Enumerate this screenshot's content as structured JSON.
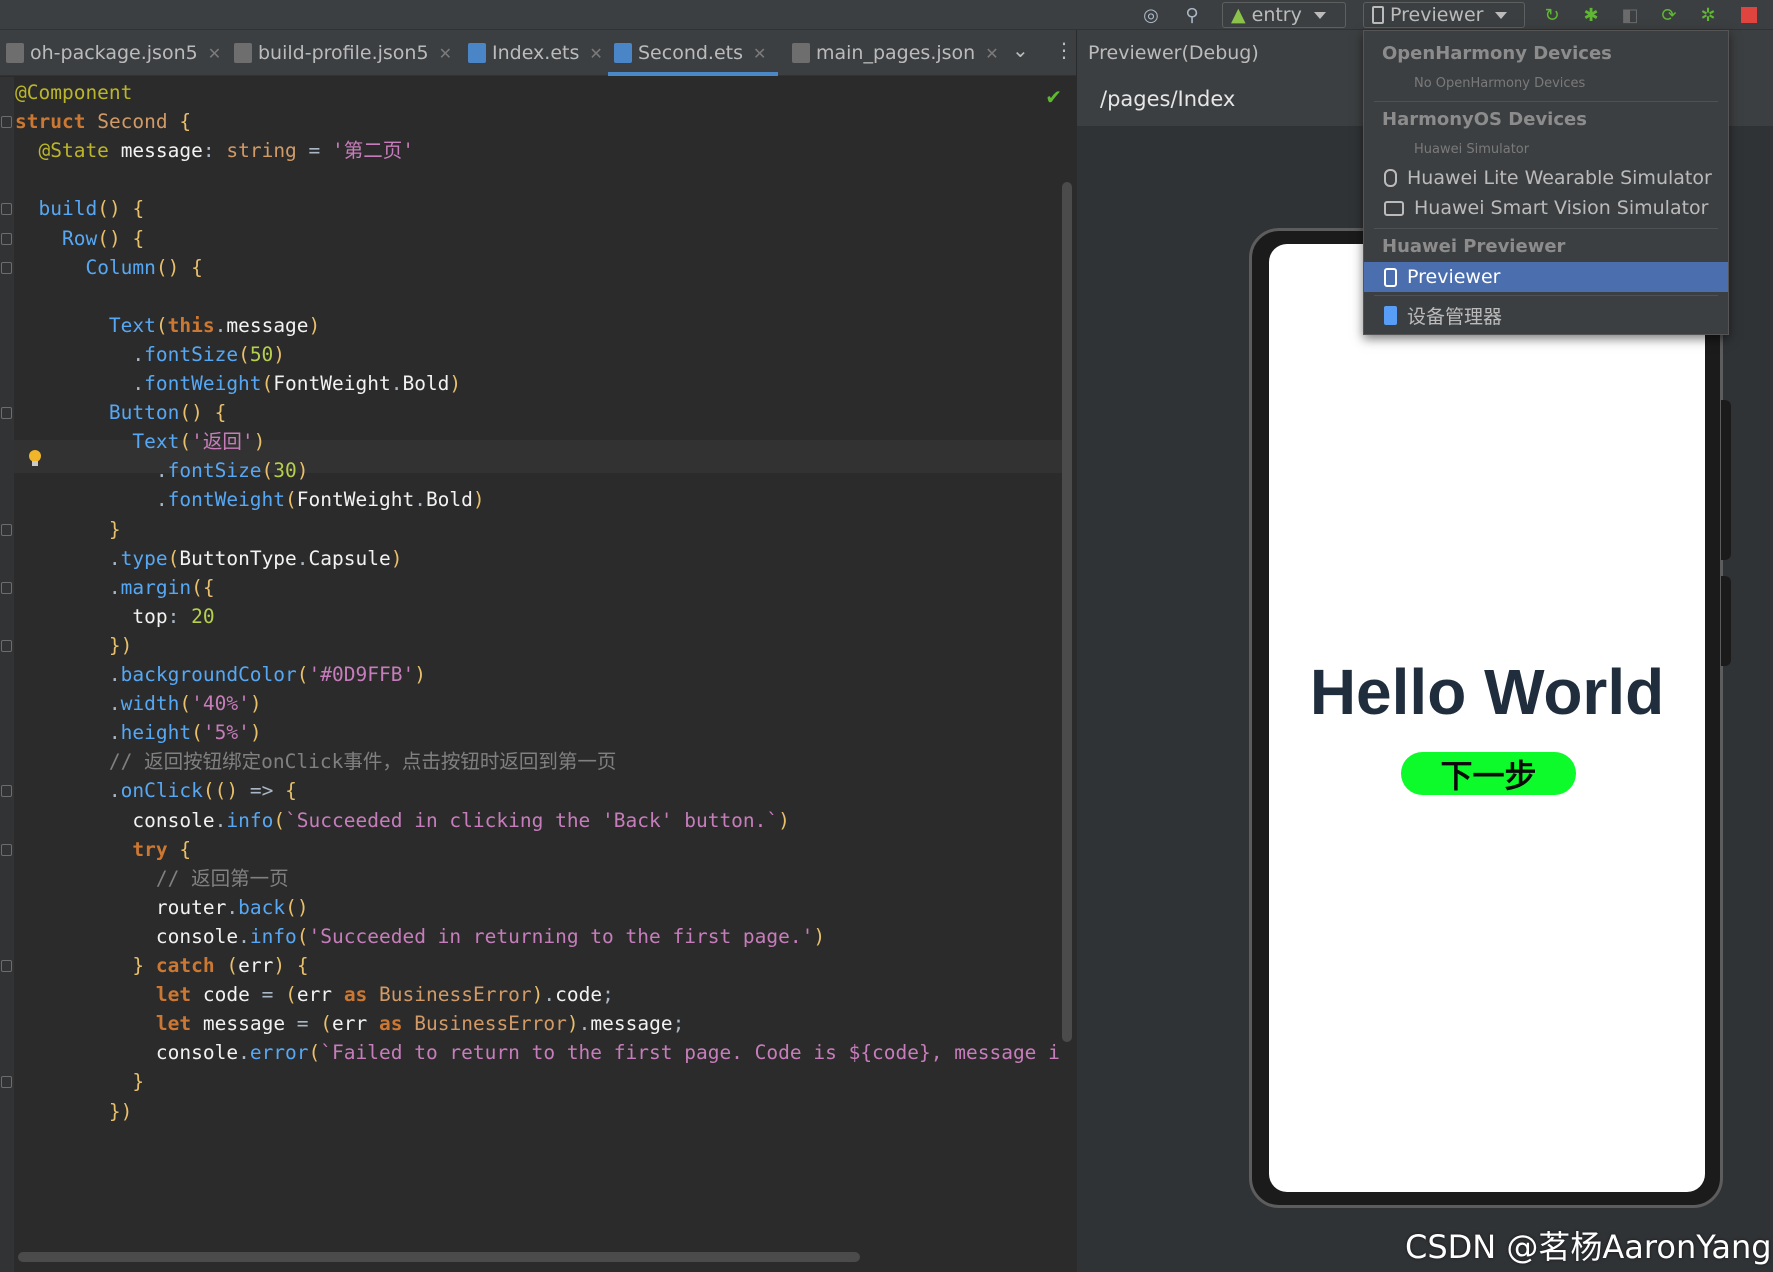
{
  "toolbar": {
    "module_combo": "entry",
    "device_combo": "Previewer"
  },
  "tabs": [
    {
      "label": "oh-package.json5",
      "type": "json"
    },
    {
      "label": "build-profile.json5",
      "type": "json"
    },
    {
      "label": "Index.ets",
      "type": "ets"
    },
    {
      "label": "Second.ets",
      "type": "ets",
      "active": true
    },
    {
      "label": "main_pages.json",
      "type": "json"
    }
  ],
  "editor": {
    "file": "Second.ets",
    "lines": [
      "@Component",
      "struct Second {",
      "  @State message: string = '第二页'",
      "",
      "  build() {",
      "    Row() {",
      "      Column() {",
      "",
      "        Text(this.message)",
      "          .fontSize(50)",
      "          .fontWeight(FontWeight.Bold)",
      "        Button() {",
      "          Text('返回')",
      "            .fontSize(30)",
      "            .fontWeight(FontWeight.Bold)",
      "        }",
      "        .type(ButtonType.Capsule)",
      "        .margin({",
      "          top: 20",
      "        })",
      "        .backgroundColor('#0D9FFB')",
      "        .width('40%')",
      "        .height('5%')",
      "        // 返回按钮绑定onClick事件，点击按钮时返回到第一页",
      "        .onClick(() => {",
      "          console.info(`Succeeded in clicking the 'Back' button.`)",
      "          try {",
      "            // 返回第一页",
      "            router.back()",
      "            console.info('Succeeded in returning to the first page.')",
      "          } catch (err) {",
      "            let code = (err as BusinessError).code;",
      "            let message = (err as BusinessError).message;",
      "            console.error(`Failed to return to the first page. Code is ${code}, message i",
      "          }",
      "        })"
    ]
  },
  "previewer": {
    "title": "Previewer(Debug)",
    "path": "/pages/Index",
    "screen": {
      "heading": "Hello World",
      "button_label": "下一步",
      "button_color": "#0DFA2B"
    }
  },
  "dropdown": {
    "groups": [
      {
        "header": "OpenHarmony Devices",
        "subtitle": "No OpenHarmony Devices",
        "items": []
      },
      {
        "header": "HarmonyOS Devices",
        "subtitle": "Huawei Simulator",
        "items": [
          {
            "label": "Huawei Lite Wearable Simulator",
            "icon": "watch-icon"
          },
          {
            "label": "Huawei Smart Vision Simulator",
            "icon": "camera-icon"
          }
        ]
      },
      {
        "header": "Huawei Previewer",
        "items": [
          {
            "label": "Previewer",
            "icon": "phone-icon",
            "selected": true
          }
        ]
      }
    ],
    "footer_item": {
      "label": "设备管理器",
      "icon": "device-manager-icon"
    }
  },
  "watermark": "CSDN @茗杨AaronYang",
  "colors": {
    "accent": "#4A88C7",
    "selection": "#4B6EAF",
    "check": "#5FB832"
  }
}
